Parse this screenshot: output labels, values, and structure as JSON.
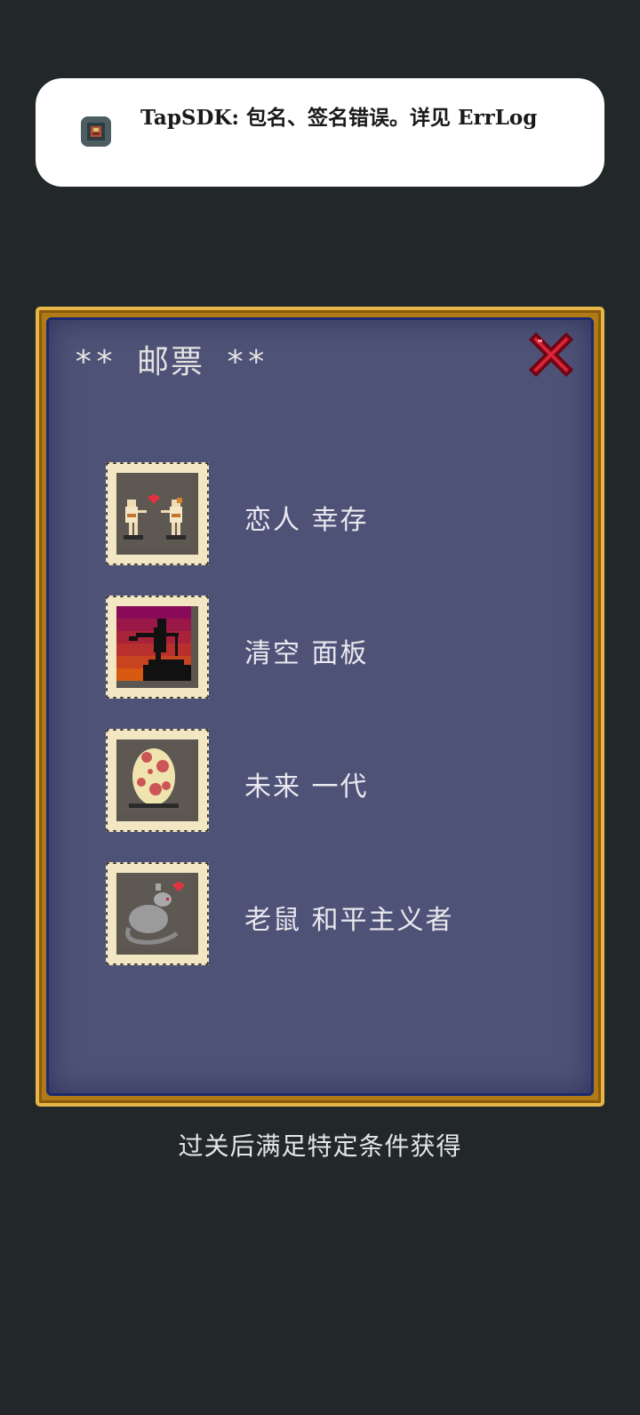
{
  "toast": {
    "icon": "app-icon",
    "message": "TapSDK: 包名、签名错误。详见 ErrLog"
  },
  "panel": {
    "title": "** 邮票 **",
    "close_icon": "close-x-icon",
    "accent_gold": "#e6b649",
    "panel_bg": "#4f5277"
  },
  "stamps": [
    {
      "label": "恋人 幸存",
      "icon": "lovers-stamp-icon"
    },
    {
      "label": "清空 面板",
      "icon": "sunset-figure-stamp-icon"
    },
    {
      "label": "未来 一代",
      "icon": "spotted-egg-stamp-icon"
    },
    {
      "label": "老鼠 和平主义者",
      "icon": "rat-heart-stamp-icon"
    }
  ],
  "footer": {
    "caption": "过关后满足特定条件获得"
  }
}
